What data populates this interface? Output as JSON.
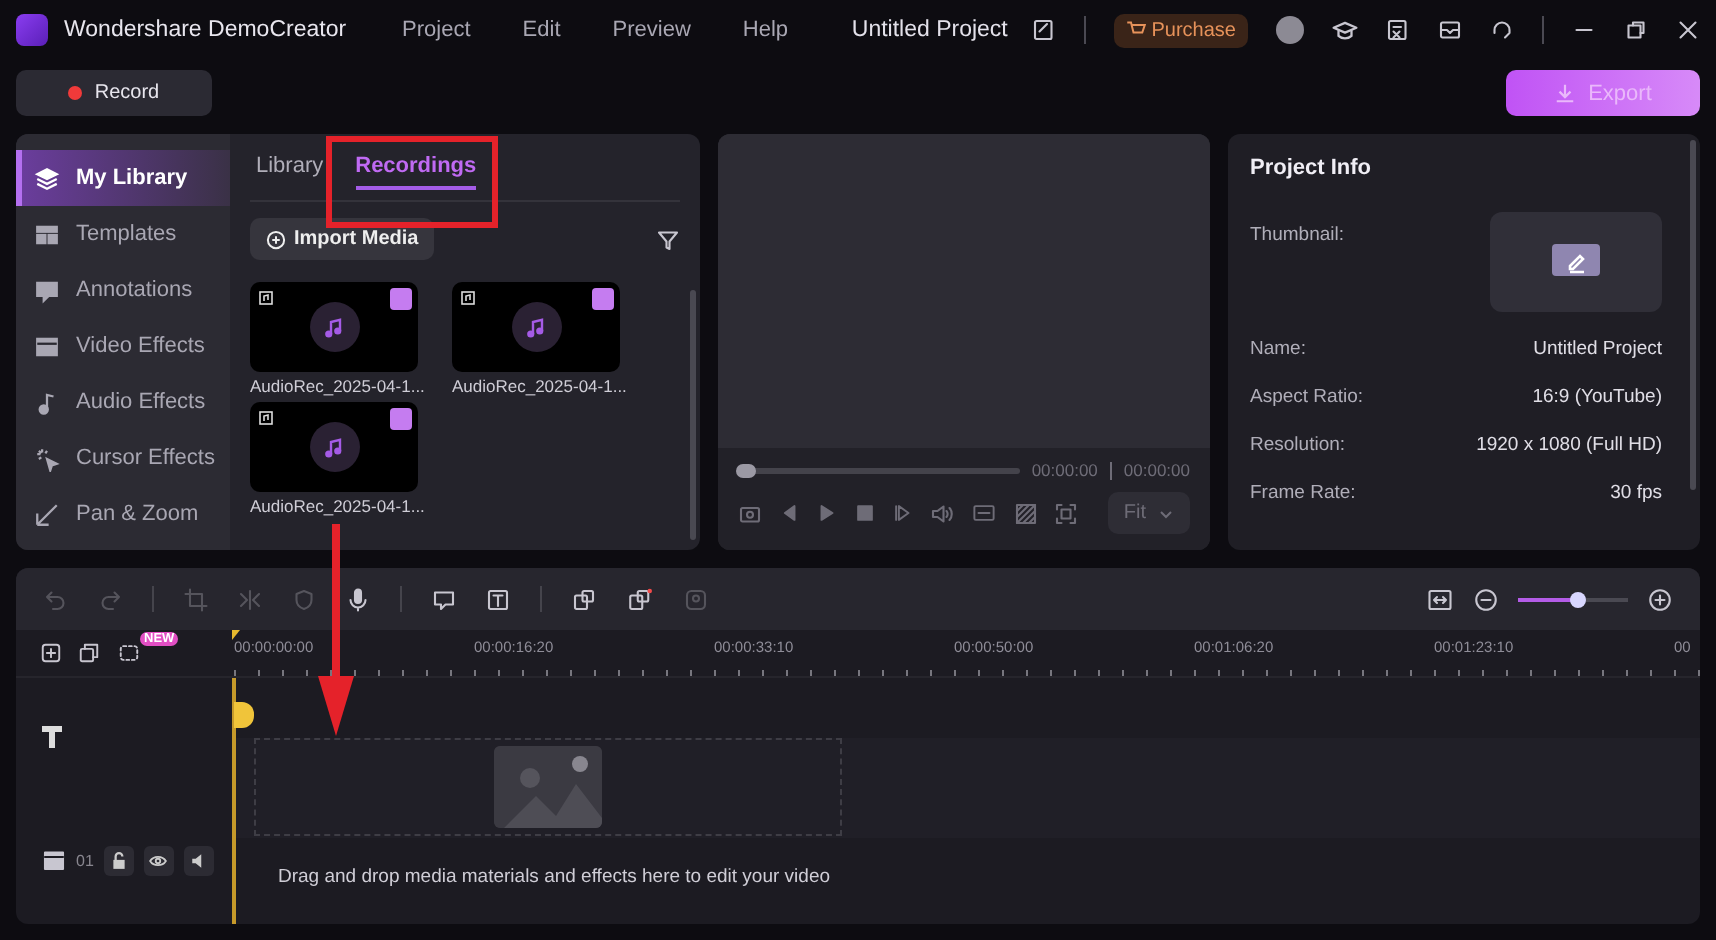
{
  "titlebar": {
    "app_name": "Wondershare DemoCreator",
    "menu": [
      "Project",
      "Edit",
      "Preview",
      "Help"
    ],
    "project_title": "Untitled Project",
    "purchase": "Purchase"
  },
  "actions": {
    "record": "Record",
    "export": {
      "label": "Export",
      "disabled": true
    }
  },
  "sidebar": {
    "items": [
      {
        "label": "My Library",
        "selected": true
      },
      {
        "label": "Templates",
        "selected": false
      },
      {
        "label": "Annotations",
        "selected": false
      },
      {
        "label": "Video Effects",
        "selected": false
      },
      {
        "label": "Audio Effects",
        "selected": false
      },
      {
        "label": "Cursor Effects",
        "selected": false
      },
      {
        "label": "Pan & Zoom",
        "selected": false
      }
    ]
  },
  "library": {
    "tabs": [
      {
        "label": "Library",
        "selected": false
      },
      {
        "label": "Recordings",
        "selected": true
      }
    ],
    "import_button": "Import Media",
    "items": [
      {
        "name": "AudioRec_2025-04-1..."
      },
      {
        "name": "AudioRec_2025-04-1..."
      },
      {
        "name": "AudioRec_2025-04-1..."
      }
    ]
  },
  "preview": {
    "progress": {
      "level": 0
    },
    "current_time": "00:00:00",
    "total_time": "00:00:00",
    "fit": "Fit"
  },
  "project_info": {
    "title": "Project Info",
    "thumbnail_label": "Thumbnail:",
    "fields": [
      {
        "label": "Name:",
        "value": "Untitled Project"
      },
      {
        "label": "Aspect Ratio:",
        "value": "16:9 (YouTube)"
      },
      {
        "label": "Resolution:",
        "value": "1920 x 1080 (Full HD)"
      },
      {
        "label": "Frame Rate:",
        "value": "30 fps"
      }
    ]
  },
  "timeline": {
    "zoom": {
      "level": 0.55
    },
    "new_badge": "NEW",
    "ruler": [
      "00:00:00:00",
      "00:00:16:20",
      "00:00:33:10",
      "00:00:50:00",
      "00:01:06:20",
      "00:01:23:10",
      "00"
    ],
    "track_number": "01",
    "drop_hint": "Drag and drop media materials and effects here to edit your video"
  }
}
